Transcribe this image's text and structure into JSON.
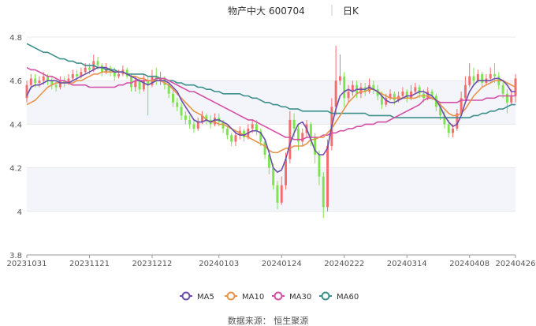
{
  "header": {
    "name": "物产中大",
    "code": "600704",
    "period": "日K"
  },
  "source_label": "数据来源：  恒生聚源",
  "colors": {
    "up": "#f56c6c",
    "down": "#7de34e",
    "ma5": "#6b4faa",
    "ma10": "#e8934a",
    "ma30": "#d54fa6",
    "ma60": "#3d8f8b",
    "grid": "#e8e8e8",
    "band": "#f3f5fa",
    "axis_text": "#555555",
    "title_text": "#333333"
  },
  "chart_data": {
    "type": "candlestick",
    "title": "物产中大 600704 日K",
    "y_ticks": [
      "3.8",
      "4",
      "4.2",
      "4.4",
      "4.6",
      "4.8"
    ],
    "ylim": [
      3.8,
      4.8
    ],
    "x_ticks": [
      {
        "label": "20231031",
        "index": 0
      },
      {
        "label": "20231121",
        "index": 15
      },
      {
        "label": "20231212",
        "index": 30
      },
      {
        "label": "20240103",
        "index": 46
      },
      {
        "label": "20240124",
        "index": 61
      },
      {
        "label": "20240222",
        "index": 76
      },
      {
        "label": "20240314",
        "index": 91
      },
      {
        "label": "20240408",
        "index": 106
      },
      {
        "label": "20240426",
        "index": 117
      }
    ],
    "legend": [
      "MA5",
      "MA10",
      "MA30",
      "MA60"
    ],
    "legend_position": "bottom",
    "candles": [
      [
        4.52,
        4.58,
        4.6,
        4.5
      ],
      [
        4.58,
        4.61,
        4.63,
        4.56
      ],
      [
        4.61,
        4.59,
        4.63,
        4.57
      ],
      [
        4.59,
        4.6,
        4.62,
        4.57
      ],
      [
        4.6,
        4.62,
        4.64,
        4.58
      ],
      [
        4.62,
        4.6,
        4.63,
        4.58
      ],
      [
        4.6,
        4.58,
        4.62,
        4.56
      ],
      [
        4.58,
        4.57,
        4.6,
        4.55
      ],
      [
        4.57,
        4.6,
        4.62,
        4.56
      ],
      [
        4.6,
        4.59,
        4.62,
        4.57
      ],
      [
        4.59,
        4.61,
        4.63,
        4.58
      ],
      [
        4.61,
        4.63,
        4.65,
        4.6
      ],
      [
        4.63,
        4.62,
        4.65,
        4.6
      ],
      [
        4.62,
        4.64,
        4.66,
        4.61
      ],
      [
        4.64,
        4.66,
        4.68,
        4.63
      ],
      [
        4.66,
        4.65,
        4.68,
        4.63
      ],
      [
        4.65,
        4.69,
        4.72,
        4.64
      ],
      [
        4.69,
        4.67,
        4.71,
        4.65
      ],
      [
        4.67,
        4.64,
        4.68,
        4.62
      ],
      [
        4.64,
        4.66,
        4.68,
        4.63
      ],
      [
        4.66,
        4.64,
        4.67,
        4.62
      ],
      [
        4.64,
        4.62,
        4.66,
        4.6
      ],
      [
        4.62,
        4.63,
        4.65,
        4.61
      ],
      [
        4.63,
        4.65,
        4.67,
        4.62
      ],
      [
        4.65,
        4.62,
        4.66,
        4.61
      ],
      [
        4.62,
        4.57,
        4.63,
        4.55
      ],
      [
        4.57,
        4.6,
        4.62,
        4.55
      ],
      [
        4.6,
        4.56,
        4.61,
        4.54
      ],
      [
        4.56,
        4.6,
        4.63,
        4.55
      ],
      [
        4.6,
        4.58,
        4.62,
        4.44
      ],
      [
        4.58,
        4.62,
        4.65,
        4.57
      ],
      [
        4.62,
        4.6,
        4.66,
        4.58
      ],
      [
        4.6,
        4.61,
        4.64,
        4.58
      ],
      [
        4.61,
        4.58,
        4.62,
        4.56
      ],
      [
        4.58,
        4.54,
        4.59,
        4.52
      ],
      [
        4.54,
        4.5,
        4.56,
        4.48
      ],
      [
        4.5,
        4.48,
        4.52,
        4.46
      ],
      [
        4.48,
        4.44,
        4.5,
        4.42
      ],
      [
        4.44,
        4.42,
        4.46,
        4.4
      ],
      [
        4.42,
        4.4,
        4.44,
        4.38
      ],
      [
        4.4,
        4.38,
        4.42,
        4.36
      ],
      [
        4.38,
        4.41,
        4.43,
        4.37
      ],
      [
        4.41,
        4.44,
        4.46,
        4.4
      ],
      [
        4.44,
        4.42,
        4.45,
        4.4
      ],
      [
        4.42,
        4.4,
        4.44,
        4.38
      ],
      [
        4.4,
        4.43,
        4.45,
        4.39
      ],
      [
        4.43,
        4.41,
        4.45,
        4.39
      ],
      [
        4.41,
        4.38,
        4.42,
        4.36
      ],
      [
        4.38,
        4.35,
        4.39,
        4.33
      ],
      [
        4.35,
        4.32,
        4.36,
        4.3
      ],
      [
        4.32,
        4.35,
        4.37,
        4.3
      ],
      [
        4.35,
        4.37,
        4.39,
        4.33
      ],
      [
        4.37,
        4.34,
        4.38,
        4.32
      ],
      [
        4.34,
        4.38,
        4.4,
        4.33
      ],
      [
        4.38,
        4.4,
        4.42,
        4.36
      ],
      [
        4.4,
        4.37,
        4.42,
        4.35
      ],
      [
        4.37,
        4.32,
        4.38,
        4.3
      ],
      [
        4.32,
        4.26,
        4.33,
        4.24
      ],
      [
        4.26,
        4.2,
        4.28,
        4.17
      ],
      [
        4.2,
        4.12,
        4.22,
        4.1
      ],
      [
        4.12,
        4.04,
        4.14,
        4.01
      ],
      [
        4.04,
        4.12,
        4.16,
        4.03
      ],
      [
        4.12,
        4.24,
        4.27,
        4.1
      ],
      [
        4.24,
        4.42,
        4.46,
        4.22
      ],
      [
        4.42,
        4.38,
        4.45,
        4.34
      ],
      [
        4.38,
        4.32,
        4.4,
        4.28
      ],
      [
        4.32,
        4.36,
        4.38,
        4.3
      ],
      [
        4.36,
        4.4,
        4.42,
        4.34
      ],
      [
        4.4,
        4.34,
        4.41,
        4.3
      ],
      [
        4.34,
        4.26,
        4.36,
        4.22
      ],
      [
        4.26,
        4.16,
        4.28,
        4.12
      ],
      [
        4.16,
        4.02,
        4.18,
        3.97
      ],
      [
        4.02,
        4.3,
        4.33,
        4.0
      ],
      [
        4.3,
        4.48,
        4.52,
        4.28
      ],
      [
        4.48,
        4.6,
        4.76,
        4.44
      ],
      [
        4.6,
        4.62,
        4.72,
        4.58
      ],
      [
        4.62,
        4.52,
        4.64,
        4.48
      ],
      [
        4.52,
        4.55,
        4.58,
        4.5
      ],
      [
        4.55,
        4.58,
        4.6,
        4.53
      ],
      [
        4.58,
        4.54,
        4.6,
        4.52
      ],
      [
        4.54,
        4.57,
        4.59,
        4.52
      ],
      [
        4.57,
        4.55,
        4.59,
        4.53
      ],
      [
        4.55,
        4.58,
        4.61,
        4.54
      ],
      [
        4.58,
        4.56,
        4.6,
        4.54
      ],
      [
        4.56,
        4.53,
        4.58,
        4.51
      ],
      [
        4.53,
        4.49,
        4.55,
        4.47
      ],
      [
        4.49,
        4.52,
        4.54,
        4.48
      ],
      [
        4.52,
        4.54,
        4.56,
        4.51
      ],
      [
        4.54,
        4.51,
        4.55,
        4.49
      ],
      [
        4.51,
        4.53,
        4.55,
        4.5
      ],
      [
        4.53,
        4.55,
        4.57,
        4.52
      ],
      [
        4.55,
        4.52,
        4.56,
        4.5
      ],
      [
        4.52,
        4.55,
        4.58,
        4.51
      ],
      [
        4.55,
        4.57,
        4.59,
        4.54
      ],
      [
        4.57,
        4.54,
        4.58,
        4.52
      ],
      [
        4.54,
        4.52,
        4.56,
        4.5
      ],
      [
        4.52,
        4.55,
        4.57,
        4.51
      ],
      [
        4.55,
        4.53,
        4.56,
        4.51
      ],
      [
        4.53,
        4.48,
        4.54,
        4.46
      ],
      [
        4.48,
        4.44,
        4.5,
        4.42
      ],
      [
        4.44,
        4.4,
        4.46,
        4.38
      ],
      [
        4.4,
        4.36,
        4.42,
        4.34
      ],
      [
        4.36,
        4.38,
        4.4,
        4.34
      ],
      [
        4.38,
        4.45,
        4.47,
        4.37
      ],
      [
        4.45,
        4.52,
        4.55,
        4.44
      ],
      [
        4.52,
        4.58,
        4.62,
        4.51
      ],
      [
        4.58,
        4.62,
        4.68,
        4.57
      ],
      [
        4.62,
        4.6,
        4.66,
        4.58
      ],
      [
        4.6,
        4.63,
        4.65,
        4.59
      ],
      [
        4.63,
        4.59,
        4.64,
        4.57
      ],
      [
        4.59,
        4.61,
        4.63,
        4.58
      ],
      [
        4.61,
        4.63,
        4.66,
        4.6
      ],
      [
        4.63,
        4.62,
        4.68,
        4.59
      ],
      [
        4.62,
        4.58,
        4.64,
        4.56
      ],
      [
        4.58,
        4.54,
        4.6,
        4.52
      ],
      [
        4.54,
        4.5,
        4.56,
        4.45
      ],
      [
        4.5,
        4.53,
        4.56,
        4.49
      ],
      [
        4.53,
        4.61,
        4.63,
        4.5
      ]
    ],
    "ma5": [
      4.53,
      4.57,
      4.58,
      4.58,
      4.59,
      4.6,
      4.6,
      4.6,
      4.59,
      4.59,
      4.59,
      4.6,
      4.61,
      4.62,
      4.63,
      4.64,
      4.65,
      4.66,
      4.66,
      4.66,
      4.65,
      4.64,
      4.64,
      4.64,
      4.63,
      4.62,
      4.61,
      4.6,
      4.59,
      4.58,
      4.59,
      4.6,
      4.6,
      4.6,
      4.59,
      4.57,
      4.55,
      4.51,
      4.48,
      4.45,
      4.42,
      4.41,
      4.41,
      4.42,
      4.41,
      4.42,
      4.42,
      4.41,
      4.4,
      4.38,
      4.36,
      4.35,
      4.35,
      4.36,
      4.37,
      4.37,
      4.36,
      4.33,
      4.27,
      4.2,
      4.18,
      4.19,
      4.24,
      4.31,
      4.36,
      4.4,
      4.41,
      4.38,
      4.33,
      4.28,
      4.26,
      4.26,
      4.29,
      4.39,
      4.47,
      4.53,
      4.55,
      4.56,
      4.55,
      4.56,
      4.56,
      4.56,
      4.57,
      4.56,
      4.55,
      4.53,
      4.51,
      4.5,
      4.5,
      4.51,
      4.52,
      4.53,
      4.53,
      4.54,
      4.55,
      4.55,
      4.54,
      4.53,
      4.51,
      4.48,
      4.44,
      4.41,
      4.39,
      4.4,
      4.44,
      4.5,
      4.55,
      4.58,
      4.6,
      4.6,
      4.6,
      4.6,
      4.61,
      4.61,
      4.6,
      4.58,
      4.55,
      4.55
    ],
    "ma10": [
      4.49,
      4.5,
      4.51,
      4.53,
      4.55,
      4.57,
      4.58,
      4.59,
      4.59,
      4.59,
      4.59,
      4.59,
      4.6,
      4.6,
      4.61,
      4.62,
      4.63,
      4.63,
      4.64,
      4.64,
      4.64,
      4.64,
      4.64,
      4.64,
      4.63,
      4.62,
      4.62,
      4.61,
      4.61,
      4.6,
      4.6,
      4.6,
      4.6,
      4.59,
      4.58,
      4.56,
      4.54,
      4.52,
      4.5,
      4.48,
      4.46,
      4.45,
      4.44,
      4.42,
      4.41,
      4.41,
      4.4,
      4.4,
      4.39,
      4.38,
      4.37,
      4.36,
      4.35,
      4.34,
      4.33,
      4.32,
      4.31,
      4.3,
      4.28,
      4.27,
      4.27,
      4.28,
      4.29,
      4.29,
      4.3,
      4.3,
      4.3,
      4.31,
      4.33,
      4.33,
      4.34,
      4.34,
      4.36,
      4.38,
      4.41,
      4.44,
      4.47,
      4.5,
      4.52,
      4.54,
      4.55,
      4.55,
      4.56,
      4.56,
      4.55,
      4.54,
      4.53,
      4.52,
      4.52,
      4.52,
      4.52,
      4.52,
      4.52,
      4.52,
      4.53,
      4.53,
      4.53,
      4.52,
      4.51,
      4.49,
      4.47,
      4.45,
      4.44,
      4.44,
      4.45,
      4.47,
      4.5,
      4.53,
      4.55,
      4.57,
      4.58,
      4.59,
      4.6,
      4.6,
      4.6,
      4.59,
      4.58,
      4.57
    ],
    "ma30": [
      4.66,
      4.65,
      4.65,
      4.64,
      4.63,
      4.62,
      4.62,
      4.61,
      4.6,
      4.6,
      4.59,
      4.58,
      4.58,
      4.58,
      4.58,
      4.57,
      4.57,
      4.57,
      4.57,
      4.57,
      4.57,
      4.57,
      4.58,
      4.58,
      4.59,
      4.59,
      4.6,
      4.6,
      4.6,
      4.6,
      4.6,
      4.61,
      4.61,
      4.61,
      4.6,
      4.59,
      4.58,
      4.57,
      4.56,
      4.55,
      4.55,
      4.54,
      4.53,
      4.52,
      4.51,
      4.5,
      4.49,
      4.48,
      4.47,
      4.46,
      4.45,
      4.44,
      4.43,
      4.42,
      4.42,
      4.41,
      4.4,
      4.39,
      4.38,
      4.37,
      4.36,
      4.35,
      4.34,
      4.34,
      4.33,
      4.33,
      4.33,
      4.34,
      4.34,
      4.34,
      4.34,
      4.35,
      4.35,
      4.36,
      4.36,
      4.37,
      4.37,
      4.38,
      4.38,
      4.39,
      4.39,
      4.4,
      4.4,
      4.4,
      4.41,
      4.41,
      4.41,
      4.42,
      4.43,
      4.44,
      4.45,
      4.46,
      4.47,
      4.48,
      4.49,
      4.51,
      4.52,
      4.52,
      4.51,
      4.5,
      4.5,
      4.5,
      4.5,
      4.5,
      4.51,
      4.51,
      4.51,
      4.51,
      4.51,
      4.51,
      4.52,
      4.52,
      4.52,
      4.53,
      4.53,
      4.53,
      4.53,
      4.53
    ],
    "ma60": [
      4.77,
      4.76,
      4.75,
      4.74,
      4.73,
      4.73,
      4.72,
      4.71,
      4.7,
      4.7,
      4.69,
      4.69,
      4.68,
      4.68,
      4.67,
      4.67,
      4.67,
      4.66,
      4.66,
      4.65,
      4.65,
      4.65,
      4.64,
      4.64,
      4.63,
      4.63,
      4.63,
      4.63,
      4.63,
      4.62,
      4.62,
      4.62,
      4.61,
      4.61,
      4.6,
      4.6,
      4.59,
      4.59,
      4.58,
      4.58,
      4.58,
      4.57,
      4.57,
      4.56,
      4.56,
      4.55,
      4.55,
      4.54,
      4.54,
      4.54,
      4.54,
      4.54,
      4.53,
      4.53,
      4.52,
      4.52,
      4.51,
      4.5,
      4.5,
      4.49,
      4.49,
      4.48,
      4.48,
      4.47,
      4.47,
      4.47,
      4.46,
      4.46,
      4.46,
      4.46,
      4.46,
      4.46,
      4.46,
      4.45,
      4.45,
      4.45,
      4.45,
      4.45,
      4.45,
      4.45,
      4.45,
      4.45,
      4.44,
      4.44,
      4.44,
      4.44,
      4.44,
      4.44,
      4.43,
      4.43,
      4.43,
      4.43,
      4.43,
      4.43,
      4.43,
      4.43,
      4.43,
      4.43,
      4.43,
      4.43,
      4.43,
      4.43,
      4.43,
      4.43,
      4.43,
      4.43,
      4.43,
      4.44,
      4.44,
      4.45,
      4.45,
      4.46,
      4.46,
      4.47,
      4.47,
      4.48,
      4.49,
      4.49
    ]
  }
}
